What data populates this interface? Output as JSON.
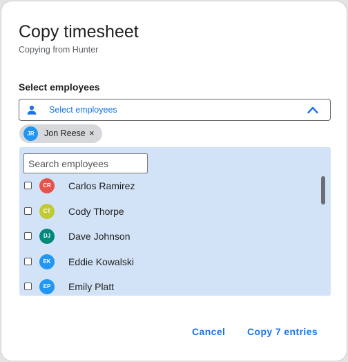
{
  "dialog": {
    "title": "Copy timesheet",
    "subtitle": "Copying from Hunter"
  },
  "employee_select": {
    "label": "Select employees",
    "placeholder": "Select employees",
    "icon": "person-icon",
    "toggle_icon": "chevron-up-icon"
  },
  "selected_chips": [
    {
      "initials": "JR",
      "name": "Jon Reese",
      "color": "#2196f3",
      "remove_glyph": "×"
    }
  ],
  "dropdown": {
    "search_placeholder": "Search employees",
    "employees": [
      {
        "initials": "CR",
        "name": "Carlos Ramirez",
        "color": "#e5534b",
        "checked": false
      },
      {
        "initials": "CT",
        "name": "Cody Thorpe",
        "color": "#c0ca33",
        "checked": false
      },
      {
        "initials": "DJ",
        "name": "Dave Johnson",
        "color": "#00897b",
        "checked": false
      },
      {
        "initials": "EK",
        "name": "Eddie Kowalski",
        "color": "#2196f3",
        "checked": false
      },
      {
        "initials": "EP",
        "name": "Emily Platt",
        "color": "#2196f3",
        "checked": false
      }
    ]
  },
  "actions": {
    "cancel_label": "Cancel",
    "copy_label": "Copy 7 entries"
  },
  "colors": {
    "accent": "#1a73e8",
    "panel_bg": "#d3e3f7",
    "chip_bg": "#d6d8dc"
  }
}
